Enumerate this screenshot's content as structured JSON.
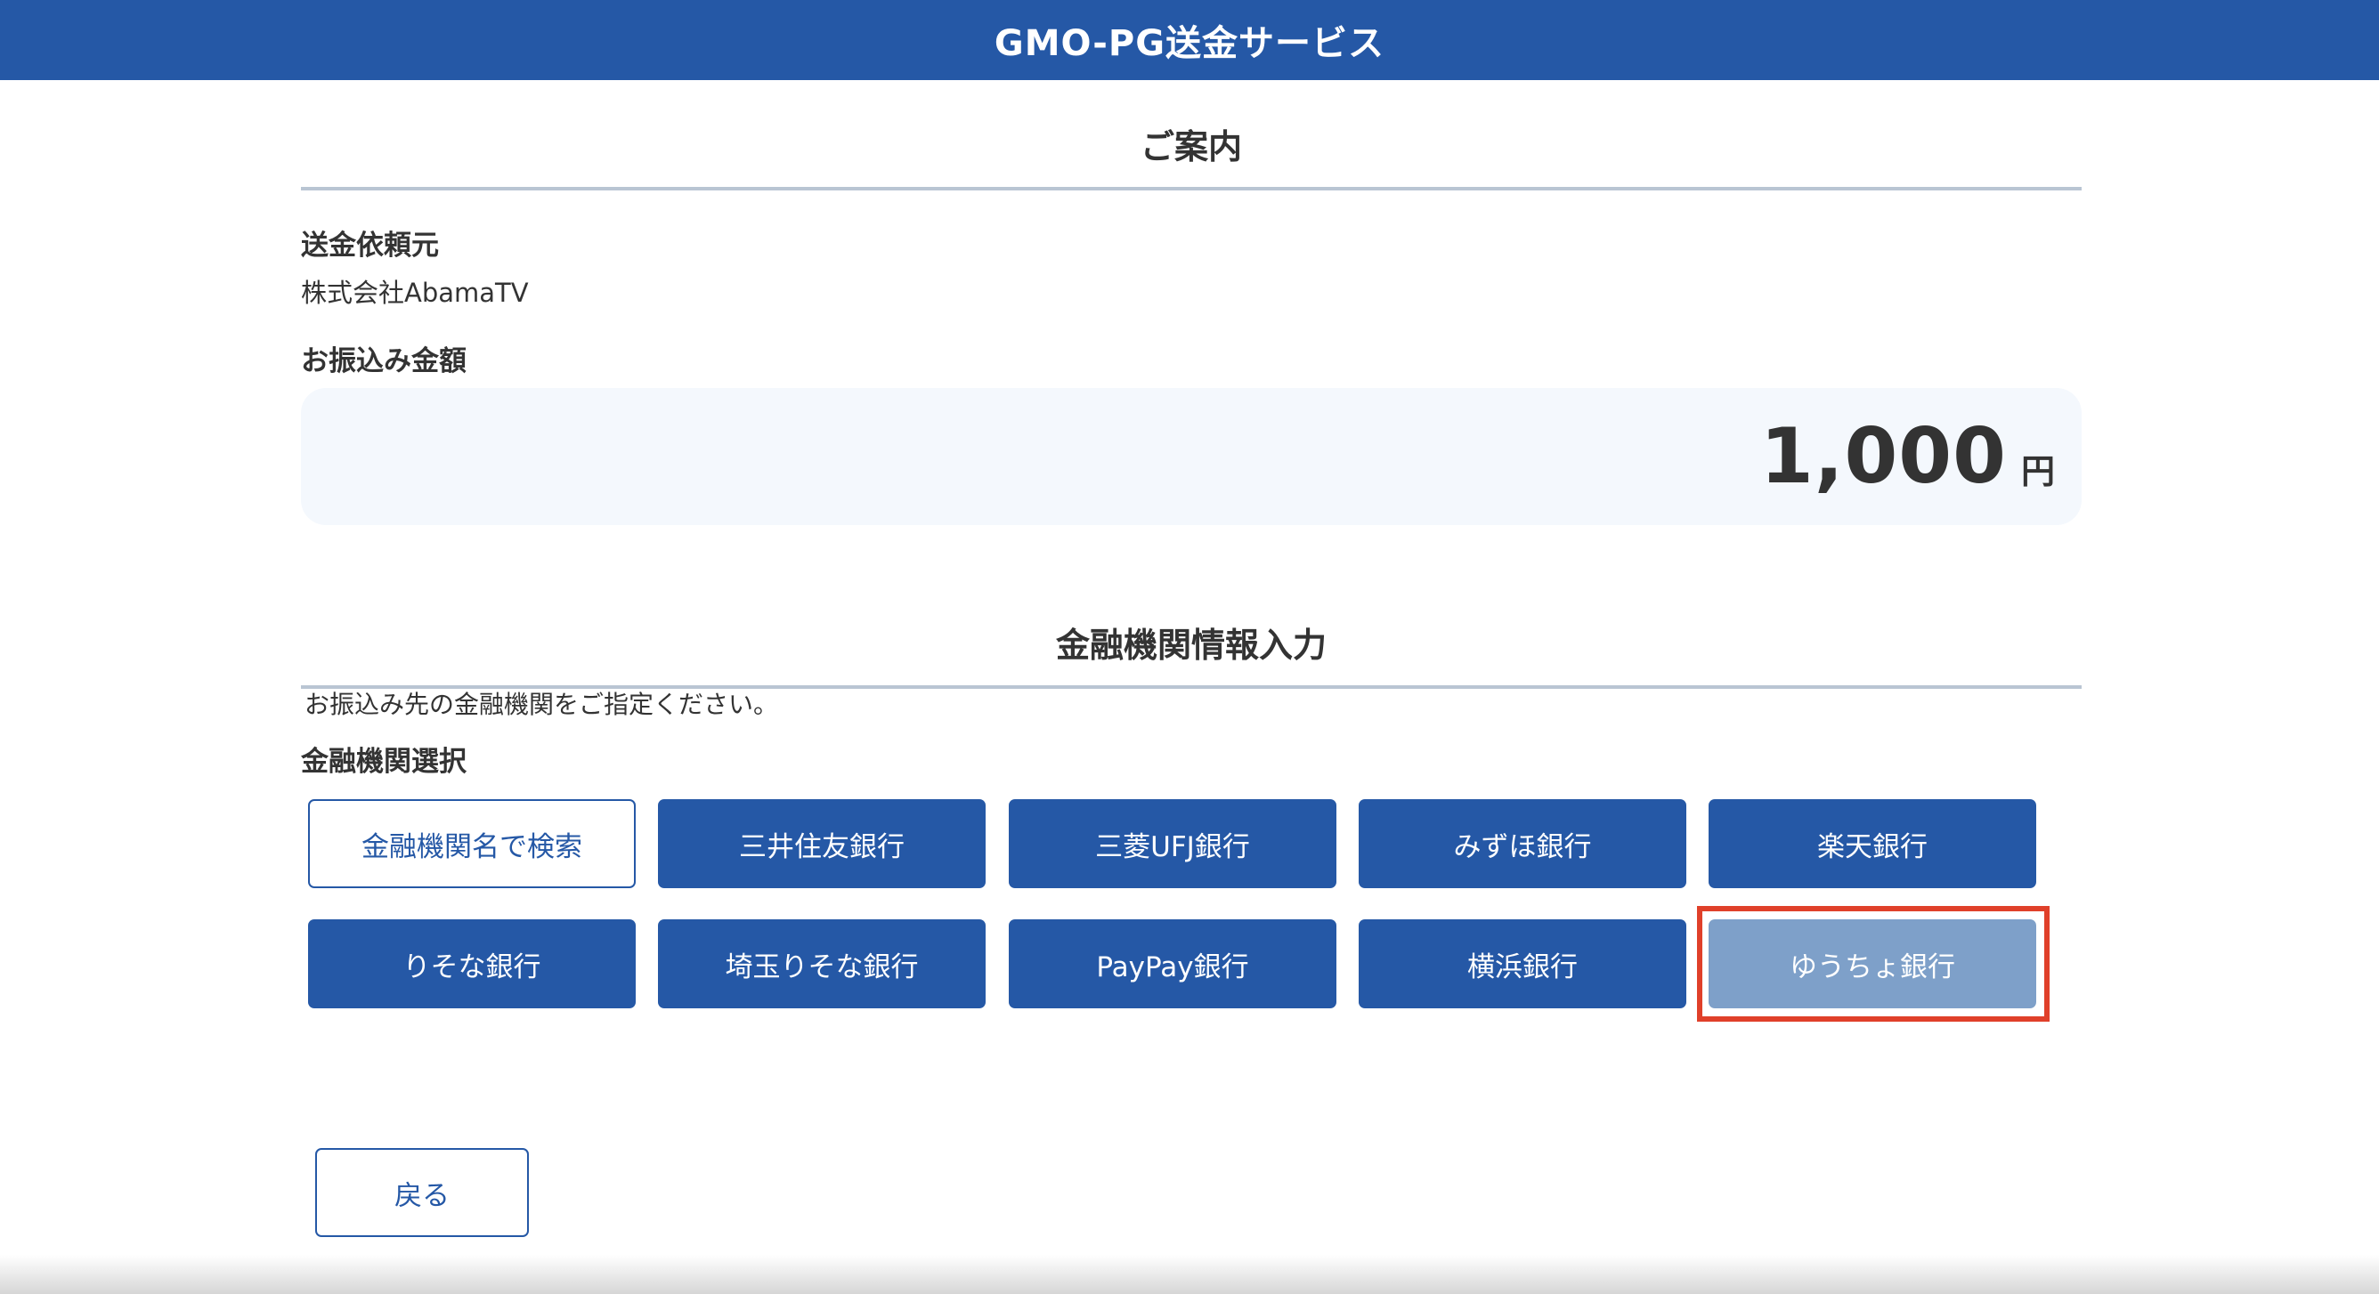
{
  "header": {
    "title": "GMO-PG送金サービス"
  },
  "guide": {
    "section_title": "ご案内",
    "sender_label": "送金依頼元",
    "sender_value": "株式会社AbamaTV",
    "amount_label": "お振込み金額",
    "amount_value": "1,000",
    "amount_unit": "円"
  },
  "bank": {
    "section_title": "金融機関情報入力",
    "instruction": "お振込み先の金融機関をご指定ください。",
    "select_label": "金融機関選択",
    "search_button": "金融機関名で検索",
    "banks": [
      "三井住友銀行",
      "三菱UFJ銀行",
      "みずほ銀行",
      "楽天銀行",
      "りそな銀行",
      "埼玉りそな銀行",
      "PayPay銀行",
      "横浜銀行",
      "ゆうちょ銀行"
    ]
  },
  "footer": {
    "back_button": "戻る"
  },
  "colors": {
    "primary": "#2558a6",
    "selected": "#7ea0c9",
    "highlight": "#e0402a",
    "amount_bg": "#f4f8fd"
  }
}
